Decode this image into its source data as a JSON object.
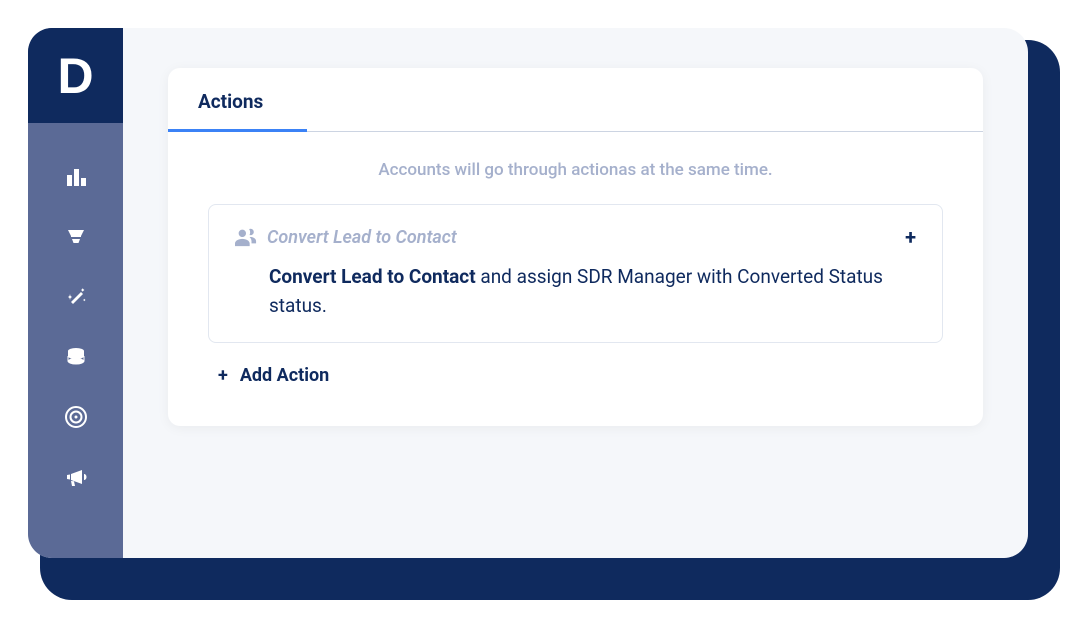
{
  "logo": "D",
  "panel": {
    "title": "Actions",
    "hint": "Accounts will go through actionas at the same time.",
    "action": {
      "label": "Convert Lead to Contact",
      "desc_bold": "Convert Lead to Contact",
      "desc_rest": " and assign SDR Manager with Converted Status status."
    },
    "add_action": "Add Action"
  }
}
